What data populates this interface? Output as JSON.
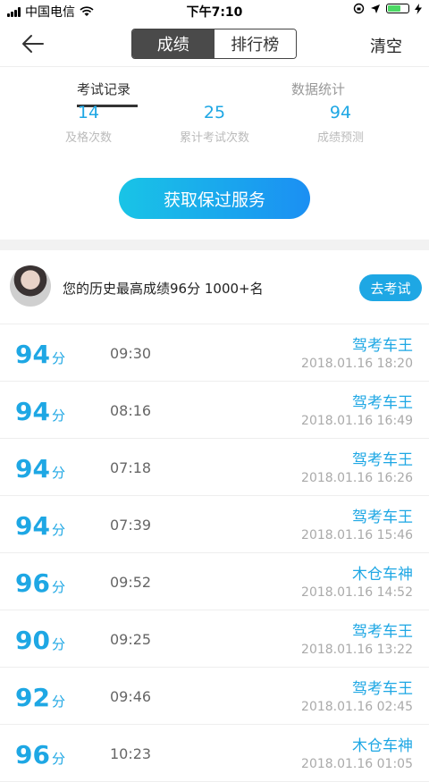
{
  "status": {
    "carrier": "中国电信",
    "time": "下午7:10",
    "battery_level": 0.7
  },
  "nav": {
    "tabs": [
      "成绩",
      "排行榜"
    ],
    "active_tab": 0,
    "clear_label": "清空"
  },
  "subtabs": [
    "考试记录",
    "数据统计"
  ],
  "stats": [
    {
      "value": "14",
      "label": "及格次数"
    },
    {
      "value": "25",
      "label": "累计考试次数"
    },
    {
      "value": "94",
      "label": "成绩预测"
    }
  ],
  "cta_label": "获取保过服务",
  "best": {
    "text": "您的历史最高成绩96分 1000+名",
    "button": "去考试"
  },
  "records": [
    {
      "score": "94",
      "unit": "分",
      "duration": "09:30",
      "title": "驾考车王",
      "date": "2018.01.16 18:20"
    },
    {
      "score": "94",
      "unit": "分",
      "duration": "08:16",
      "title": "驾考车王",
      "date": "2018.01.16 16:49"
    },
    {
      "score": "94",
      "unit": "分",
      "duration": "07:18",
      "title": "驾考车王",
      "date": "2018.01.16 16:26"
    },
    {
      "score": "94",
      "unit": "分",
      "duration": "07:39",
      "title": "驾考车王",
      "date": "2018.01.16 15:46"
    },
    {
      "score": "96",
      "unit": "分",
      "duration": "09:52",
      "title": "木仓车神",
      "date": "2018.01.16 14:52"
    },
    {
      "score": "90",
      "unit": "分",
      "duration": "09:25",
      "title": "驾考车王",
      "date": "2018.01.16 13:22"
    },
    {
      "score": "92",
      "unit": "分",
      "duration": "09:46",
      "title": "驾考车王",
      "date": "2018.01.16 02:45"
    },
    {
      "score": "96",
      "unit": "分",
      "duration": "10:23",
      "title": "木仓车神",
      "date": "2018.01.16 01:05"
    }
  ]
}
